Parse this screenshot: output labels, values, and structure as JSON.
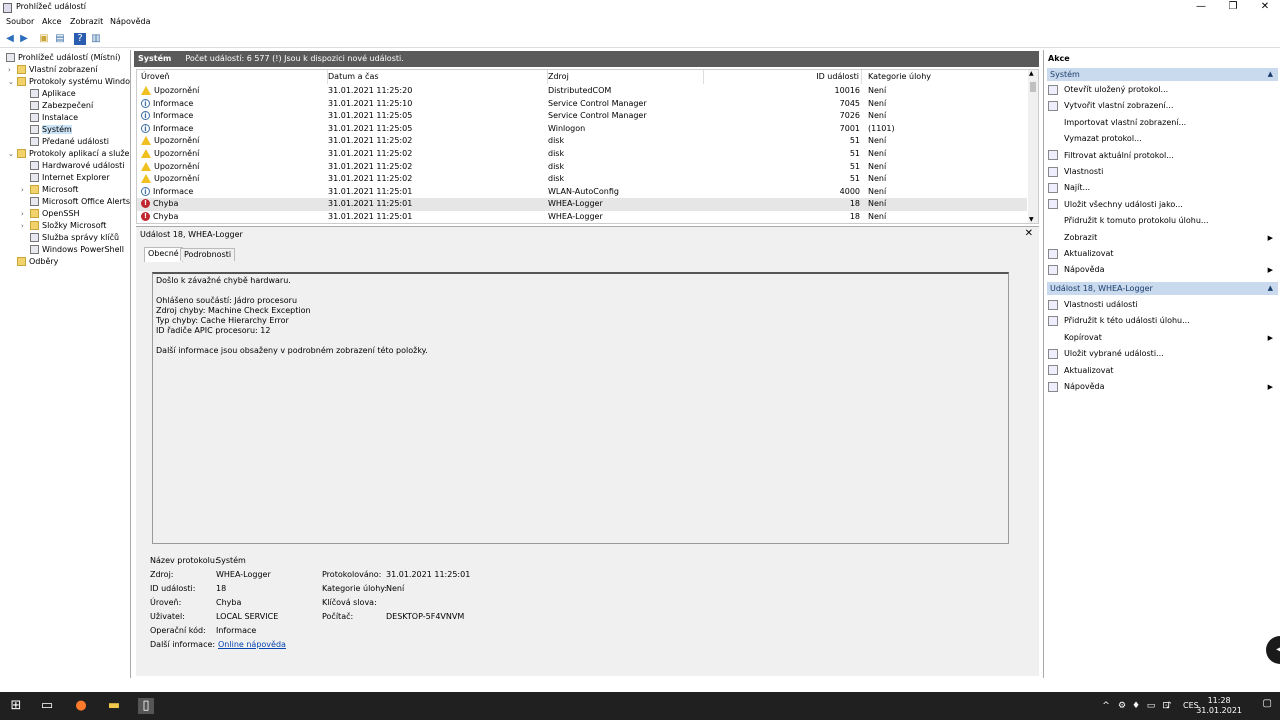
{
  "window": {
    "title": "Prohlížeč událostí"
  },
  "menu": [
    "Soubor",
    "Akce",
    "Zobrazit",
    "Nápověda"
  ],
  "tree": {
    "root": "Prohlížeč událostí (Místní)",
    "custom_views": "Vlastní zobrazení",
    "windows_logs": "Protokoly systému Windows",
    "windows_items": [
      "Aplikace",
      "Zabezpečení",
      "Instalace",
      "Systém",
      "Předané události"
    ],
    "app_services": "Protokoly aplikací a služeb",
    "app_items": [
      "Hardwarové události",
      "Internet Explorer",
      "Microsoft",
      "Microsoft Office Alerts",
      "OpenSSH",
      "Složky Microsoft",
      "Služba správy klíčů",
      "Windows PowerShell"
    ],
    "subscriptions": "Odběry"
  },
  "center": {
    "log_name": "Systém",
    "summary": "Počet událostí: 6 577 (!) Jsou k dispozici nové události.",
    "columns": [
      "Úroveň",
      "Datum a čas",
      "Zdroj",
      "ID události",
      "Kategorie úlohy"
    ],
    "rows": [
      {
        "level": "Upozornění",
        "icon": "warn",
        "date": "31.01.2021 11:25:20",
        "source": "DistributedCOM",
        "id": "10016",
        "cat": "Není"
      },
      {
        "level": "Informace",
        "icon": "info",
        "date": "31.01.2021 11:25:10",
        "source": "Service Control Manager",
        "id": "7045",
        "cat": "Není"
      },
      {
        "level": "Informace",
        "icon": "info",
        "date": "31.01.2021 11:25:05",
        "source": "Service Control Manager",
        "id": "7026",
        "cat": "Není"
      },
      {
        "level": "Informace",
        "icon": "info",
        "date": "31.01.2021 11:25:05",
        "source": "Winlogon",
        "id": "7001",
        "cat": "(1101)"
      },
      {
        "level": "Upozornění",
        "icon": "warn",
        "date": "31.01.2021 11:25:02",
        "source": "disk",
        "id": "51",
        "cat": "Není"
      },
      {
        "level": "Upozornění",
        "icon": "warn",
        "date": "31.01.2021 11:25:02",
        "source": "disk",
        "id": "51",
        "cat": "Není"
      },
      {
        "level": "Upozornění",
        "icon": "warn",
        "date": "31.01.2021 11:25:02",
        "source": "disk",
        "id": "51",
        "cat": "Není"
      },
      {
        "level": "Upozornění",
        "icon": "warn",
        "date": "31.01.2021 11:25:02",
        "source": "disk",
        "id": "51",
        "cat": "Není"
      },
      {
        "level": "Informace",
        "icon": "info",
        "date": "31.01.2021 11:25:01",
        "source": "WLAN-AutoConfig",
        "id": "4000",
        "cat": "Není"
      },
      {
        "level": "Chyba",
        "icon": "err",
        "date": "31.01.2021 11:25:01",
        "source": "WHEA-Logger",
        "id": "18",
        "cat": "Není",
        "selected": true
      },
      {
        "level": "Chyba",
        "icon": "err",
        "date": "31.01.2021 11:25:01",
        "source": "WHEA-Logger",
        "id": "18",
        "cat": "Není"
      }
    ]
  },
  "detail": {
    "title": "Událost 18, WHEA-Logger",
    "tabs": [
      "Obecné",
      "Podrobnosti"
    ],
    "description": [
      "Došlo k závažné chybě hardwaru.",
      "",
      "Ohlášeno součástí: Jádro procesoru",
      "Zdroj chyby: Machine Check Exception",
      "Typ chyby: Cache Hierarchy Error",
      "ID řadiče APIC procesoru: 12",
      "",
      "Další informace jsou obsaženy v podrobném zobrazení této položky."
    ],
    "props": {
      "log_label": "Název protokolu:",
      "log_value": "Systém",
      "source_label": "Zdroj:",
      "source_value": "WHEA-Logger",
      "logged_label": "Protokolováno:",
      "logged_value": "31.01.2021 11:25:01",
      "id_label": "ID události:",
      "id_value": "18",
      "cat_label": "Kategorie úlohy:",
      "cat_value": "Není",
      "level_label": "Úroveň:",
      "level_value": "Chyba",
      "kw_label": "Klíčová slova:",
      "kw_value": "",
      "user_label": "Uživatel:",
      "user_value": "LOCAL SERVICE",
      "pc_label": "Počítač:",
      "pc_value": "DESKTOP-5F4VNVM",
      "op_label": "Operační kód:",
      "op_value": "Informace",
      "more_label": "Další informace:",
      "more_link": "Online nápověda"
    }
  },
  "actions": {
    "header": "Akce",
    "section1": "Systém",
    "items1": [
      "Otevřít uložený protokol...",
      "Vytvořit vlastní zobrazení...",
      "Importovat vlastní zobrazení...",
      "Vymazat protokol...",
      "Filtrovat aktuální protokol...",
      "Vlastnosti",
      "Najít...",
      "Uložit všechny události jako...",
      "Přidružit k tomuto protokolu úlohu...",
      "Zobrazit",
      "Aktualizovat",
      "Nápověda"
    ],
    "section2": "Událost 18, WHEA-Logger",
    "items2": [
      "Vlastnosti události",
      "Přidružit k této události úlohu...",
      "Kopírovat",
      "Uložit vybrané události...",
      "Aktualizovat",
      "Nápověda"
    ]
  },
  "taskbar": {
    "lang": "CES",
    "time": "11:28",
    "date": "31.01.2021"
  }
}
